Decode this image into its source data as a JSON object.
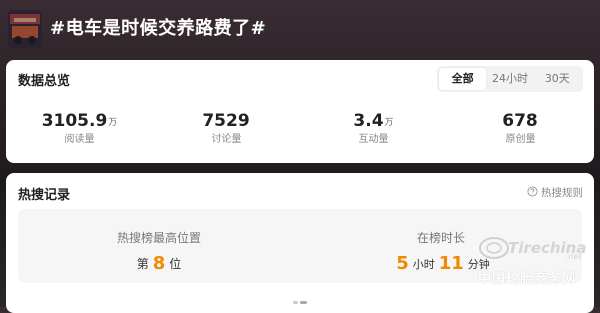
{
  "header": {
    "topic_title": "#电车是时候交养路费了#"
  },
  "overview": {
    "title": "数据总览",
    "tabs": [
      {
        "label": "全部",
        "active": true
      },
      {
        "label": "24小时",
        "active": false
      },
      {
        "label": "30天",
        "active": false
      }
    ],
    "stats": [
      {
        "value": "3105.9",
        "unit": "万",
        "label": "阅读量"
      },
      {
        "value": "7529",
        "unit": "",
        "label": "讨论量"
      },
      {
        "value": "3.4",
        "unit": "万",
        "label": "互动量"
      },
      {
        "value": "678",
        "unit": "",
        "label": "原创量"
      }
    ]
  },
  "hot_search": {
    "title": "热搜记录",
    "rule_link": "热搜规则",
    "highest_position": {
      "label": "热搜榜最高位置",
      "prefix": "第",
      "value": "8",
      "suffix": "位"
    },
    "duration": {
      "label": "在榜时长",
      "hours": "5",
      "hours_unit": "小时",
      "minutes": "11",
      "minutes_unit": "分钟"
    },
    "pager": {
      "pages": 2,
      "current": 1
    }
  },
  "watermark": {
    "logo_text": "Tirechina",
    "logo_suffix": ".net",
    "text": "中国轮胎商务网"
  },
  "colors": {
    "accent_orange": "#f08a00",
    "card_bg": "#ffffff",
    "inner_bg": "#f6f6f6"
  },
  "icons": {
    "rule": "question-circle-icon"
  }
}
